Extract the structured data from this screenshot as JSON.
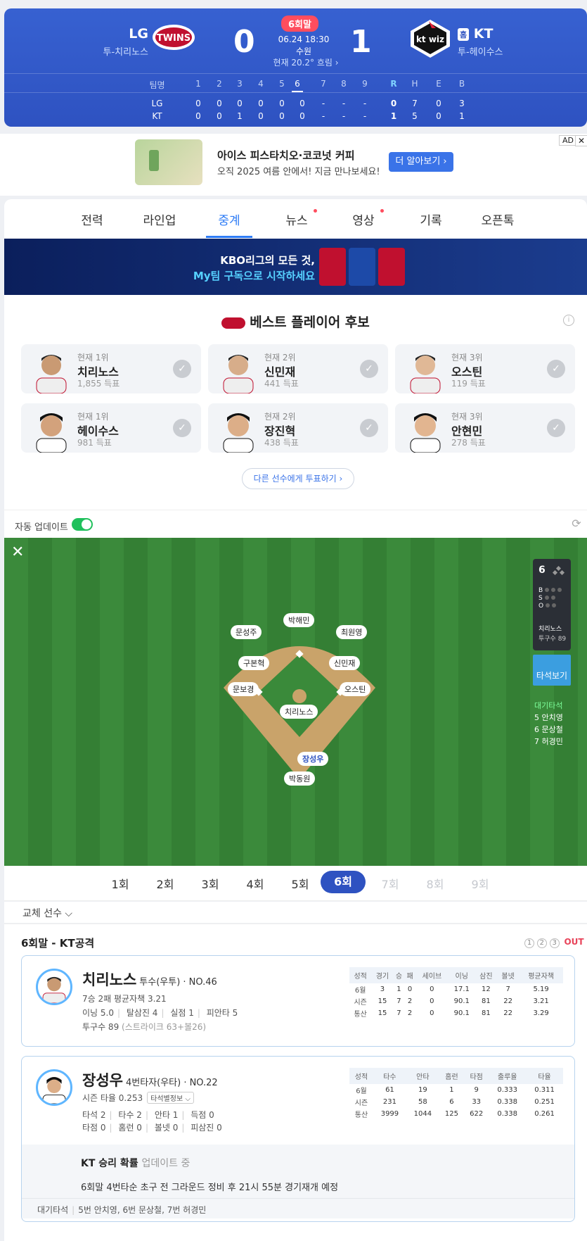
{
  "scoreboard": {
    "away_name": "LG",
    "away_pitcher": "투-치리노스",
    "away_score": "0",
    "home_name": "KT",
    "home_badge": "홈",
    "home_pitcher": "투-헤이수스",
    "home_score": "1",
    "inning_badge": "6회말",
    "datetime": "06.24 18:30",
    "stadium": "수원",
    "weather": "현재 20.2° 흐림 ›",
    "linescore": {
      "header": [
        "팀명",
        "1",
        "2",
        "3",
        "4",
        "5",
        "6",
        "7",
        "8",
        "9",
        "R",
        "H",
        "E",
        "B"
      ],
      "rows": [
        [
          "LG",
          "0",
          "0",
          "0",
          "0",
          "0",
          "0",
          "-",
          "-",
          "-",
          "0",
          "7",
          "0",
          "3"
        ],
        [
          "KT",
          "0",
          "0",
          "1",
          "0",
          "0",
          "0",
          "-",
          "-",
          "-",
          "1",
          "5",
          "0",
          "1"
        ]
      ]
    }
  },
  "ad": {
    "title": "아이스 피스타치오·코코넛 커피",
    "subtitle": "오직 2025 여름 안에서! 지금 만나보세요!",
    "button": "더 알아보기 ›",
    "badge": "AD",
    "close": "✕"
  },
  "tabs": [
    "전력",
    "라인업",
    "중계",
    "뉴스",
    "영상",
    "기록",
    "오픈톡"
  ],
  "kbo_banner": {
    "line1": "KBO리그의 모든 것,",
    "line2": "My팀 구독으로 시작하세요"
  },
  "best": {
    "title": "베스트 플레이어 후보",
    "cards": [
      {
        "rank": "현재 1위",
        "name": "치리노스",
        "votes": "1,855 득표"
      },
      {
        "rank": "현재 2위",
        "name": "신민재",
        "votes": "441 득표"
      },
      {
        "rank": "현재 3위",
        "name": "오스틴",
        "votes": "119 득표"
      },
      {
        "rank": "현재 1위",
        "name": "헤이수스",
        "votes": "981 득표"
      },
      {
        "rank": "현재 2위",
        "name": "장진혁",
        "votes": "438 득표"
      },
      {
        "rank": "현재 3위",
        "name": "안현민",
        "votes": "278 득표"
      }
    ],
    "vote_more": "다른 선수에게 투표하기 ›"
  },
  "auto_update": "자동 업데이트",
  "field": {
    "positions": {
      "cf": "박해민",
      "lf": "문성주",
      "rf": "최원영",
      "ss": "구본혁",
      "2b": "신민재",
      "3b": "문보경",
      "1b": "오스틴",
      "p": "치리노스",
      "batter": "장성우",
      "c": "박동원"
    },
    "panel": {
      "inning": "6",
      "b": "B",
      "s": "S",
      "o": "O",
      "pitcher": "치리노스",
      "pitch_count": "투구수 89"
    },
    "at_bat_button": "타석보기",
    "waiting_title": "대기타석",
    "waiting": [
      "5 안치영",
      "6 문상철",
      "7 허경민"
    ]
  },
  "innings": [
    "1회",
    "2회",
    "3회",
    "4회",
    "5회",
    "6회",
    "7회",
    "8회",
    "9회"
  ],
  "subs_label": "교체 선수 ⌵",
  "pbp": {
    "title": "6회말 - KT공격",
    "outs": [
      "1",
      "2",
      "3"
    ],
    "out_label": "OUT",
    "pitcher": {
      "name": "치리노스",
      "role": "투수(우투) · NO.46",
      "line1": "7승 2패 평균자책 3.21",
      "line2a": "이닝 5.0",
      "line2b": "탈삼진 4",
      "line2c": "실점 1",
      "line2d": "피안타 5",
      "line3": "투구수 89",
      "line3b": "(스트라이크 63+볼26)",
      "table": {
        "header": [
          "성적",
          "경기",
          "승",
          "패",
          "세이브",
          "이닝",
          "삼진",
          "볼넷",
          "평균자책"
        ],
        "rows": [
          [
            "6월",
            "3",
            "1",
            "0",
            "0",
            "17.1",
            "12",
            "7",
            "5.19"
          ],
          [
            "시즌",
            "15",
            "7",
            "2",
            "0",
            "90.1",
            "81",
            "22",
            "3.21"
          ],
          [
            "통산",
            "15",
            "7",
            "2",
            "0",
            "90.1",
            "81",
            "22",
            "3.29"
          ]
        ]
      }
    },
    "batter": {
      "name": "장성우",
      "role": "4번타자(우타) · NO.22",
      "line1": "시즌 타율 0.253",
      "dropdown": "타석별정보 ⌵",
      "line2a": "타석 2",
      "line2b": "타수 2",
      "line2c": "안타 1",
      "line2d": "득점 0",
      "line3a": "타점 0",
      "line3b": "홈런 0",
      "line3c": "볼넷 0",
      "line3d": "피삼진 0",
      "table": {
        "header": [
          "성적",
          "타수",
          "안타",
          "홈런",
          "타점",
          "출루율",
          "타율"
        ],
        "rows": [
          [
            "6월",
            "61",
            "19",
            "1",
            "9",
            "0.333",
            "0.311"
          ],
          [
            "시즌",
            "231",
            "58",
            "6",
            "33",
            "0.338",
            "0.251"
          ],
          [
            "통산",
            "3999",
            "1044",
            "125",
            "622",
            "0.338",
            "0.261"
          ]
        ]
      },
      "win_title": "KT 승리 확률",
      "win_status": "업데이트 중",
      "note": "6회말 4번타순 초구 전 그라운드 정비 후 21시 55분 경기재개 예정",
      "wait_label": "대기타석",
      "wait_text": "5번 안치영, 6번 문상철, 7번 허경민"
    }
  }
}
